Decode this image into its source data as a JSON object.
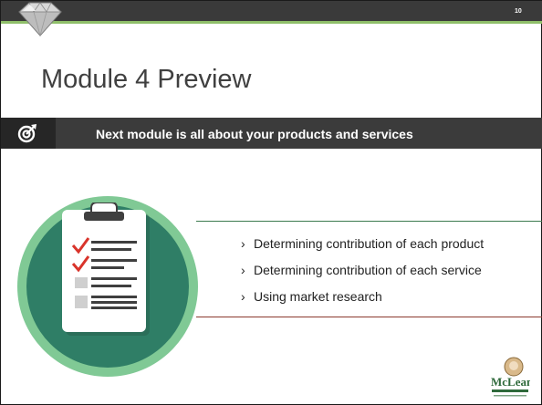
{
  "slide": {
    "number": "10",
    "title": "Module 4 Preview"
  },
  "banner": {
    "icon": "target-icon",
    "text": "Next module is all about your products and services"
  },
  "bullets": [
    "Determining contribution of each product",
    "Determining contribution of each service",
    "Using market research"
  ],
  "bullet_marker": "›",
  "colors": {
    "topbar": "#3a3a3a",
    "accent_green": "#8fbf6a",
    "banner": "#3b3b3b",
    "circle_outer": "#80c995",
    "circle_inner": "#2f7e66",
    "check_red": "#d9342b"
  },
  "logo": {
    "icon": "mclean-logo-icon",
    "text": "McLean"
  },
  "decor": {
    "icon": "diamond-icon",
    "illustration": "clipboard-checklist-icon"
  }
}
